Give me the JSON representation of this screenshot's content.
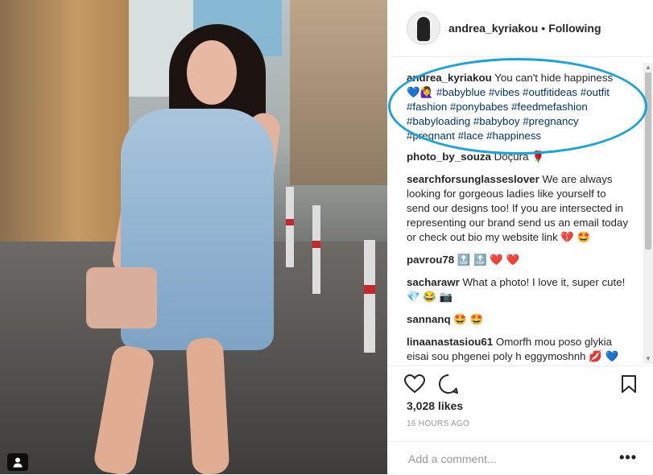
{
  "post": {
    "username": "andrea_kyriakou",
    "separator": "•",
    "follow_status": "Following",
    "likes": "3,028 likes",
    "time": "16 HOURS AGO",
    "add_comment_placeholder": "Add a comment...",
    "more_icon": "•••"
  },
  "caption": {
    "user": "andrea_kyriakou",
    "text": "You can't hide happiness",
    "emoji": "💙🙋‍♀️",
    "hashtags": [
      "#babyblue",
      "#vibes",
      "#outfitideas",
      "#outfit",
      "#fashion",
      "#ponybabes",
      "#feedmefashion",
      "#babyloading",
      "#babyboy",
      "#pregnancy",
      "#pregnant",
      "#lace",
      "#happiness"
    ]
  },
  "comments": [
    {
      "user": "photo_by_souza",
      "text": "Doçura 🌹"
    },
    {
      "user": "searchforsunglasseslover",
      "text": "We are always looking for gorgeous ladies like yourself to send our designs too! If you are intersected in representing our brand send us an email today or check out bio my website link 💔 🤩"
    },
    {
      "user": "pavrou78",
      "text": "🔝 🔝 ❤️ ❤️"
    },
    {
      "user": "sacharawr",
      "text": "What a photo! I love it, super cute! 💎 😂 📷"
    },
    {
      "user": "sannanq",
      "text": "🤩 🤩"
    },
    {
      "user": "linaanastasiou61",
      "text": "Omorfh mou poso glykia eisai sou phgenei poly h eggymoshnh 💋 💙 😍"
    }
  ],
  "icons": {
    "like": "heart-icon",
    "comment": "comment-icon",
    "save": "bookmark-icon",
    "photo_tag": "user-tag-icon"
  },
  "colors": {
    "highlight": "#1aa3d9",
    "hashtag": "#003569",
    "text": "#262626",
    "muted": "#999999"
  }
}
